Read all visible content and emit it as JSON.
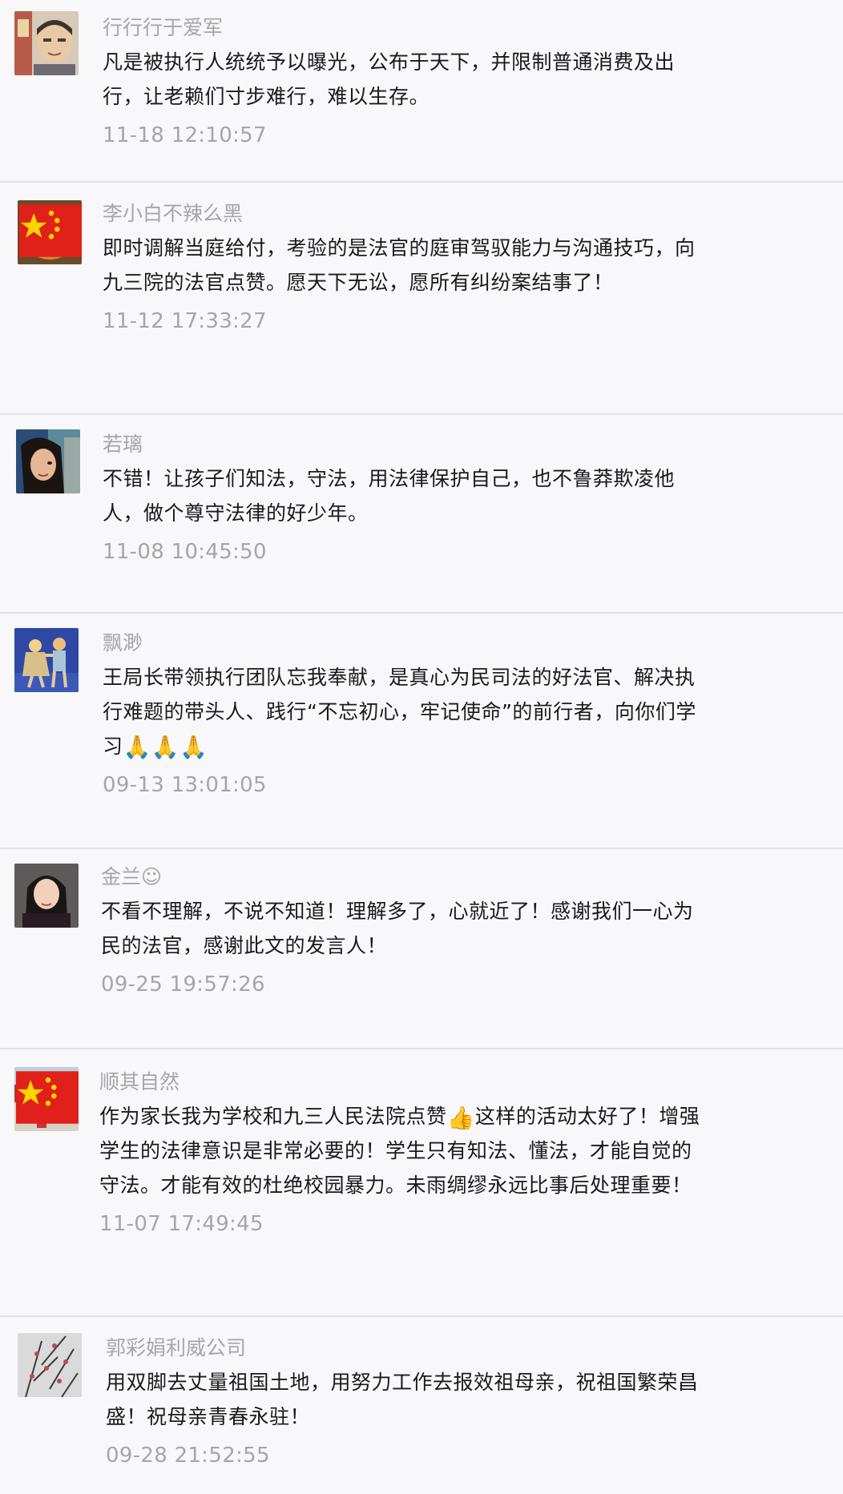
{
  "comments": [
    {
      "name": "行行行于爱军",
      "text": "凡是被执行人统统予以曝光，公布于天下，并限制普通消费及出行，让老赖们寸步难行，难以生存。",
      "time": "11-18 12:10:57"
    },
    {
      "name": "李小白不辣么黑",
      "text": "即时调解当庭给付，考验的是法官的庭审驾驭能力与沟通技巧，向九三院的法官点赞。愿天下无讼，愿所有纠纷案结事了！",
      "time": "11-12 17:33:27"
    },
    {
      "name": "若璃",
      "text": "不错！让孩子们知法，守法，用法律保护自己，也不鲁莽欺凌他人，做个尊守法律的好少年。",
      "time": "11-08 10:45:50"
    },
    {
      "name": "飘渺",
      "text": "王局长带领执行团队忘我奉献，是真心为民司法的好法官、解决执行难题的带头人、践行“不忘初心，牢记使命”的前行者，向你们学习",
      "emoji": "🙏🙏🙏",
      "time": "09-13 13:01:05"
    },
    {
      "name": "金兰☺",
      "text": "不看不理解，不说不知道！理解多了，心就近了！感谢我们一心为民的法官，感谢此文的发言人！",
      "time": "09-25 19:57:26"
    },
    {
      "name": "顺其自然",
      "text_before": "作为家长我为学校和九三人民法院点赞",
      "emoji": "👍",
      "text_after": "这样的活动太好了！增强学生的法律意识是非常必要的！学生只有知法、懂法，才能自觉的守法。才能有效的杜绝校园暴力。未雨绸缪永远比事后处理重要！",
      "time": "11-07 17:49:45"
    },
    {
      "name": "郭彩娟利威公司",
      "text": "用双脚去丈量祖国土地，用努力工作去报效祖母亲，祝祖国繁荣昌盛！祝母亲青春永驻！",
      "time": "09-28 21:52:55"
    }
  ]
}
